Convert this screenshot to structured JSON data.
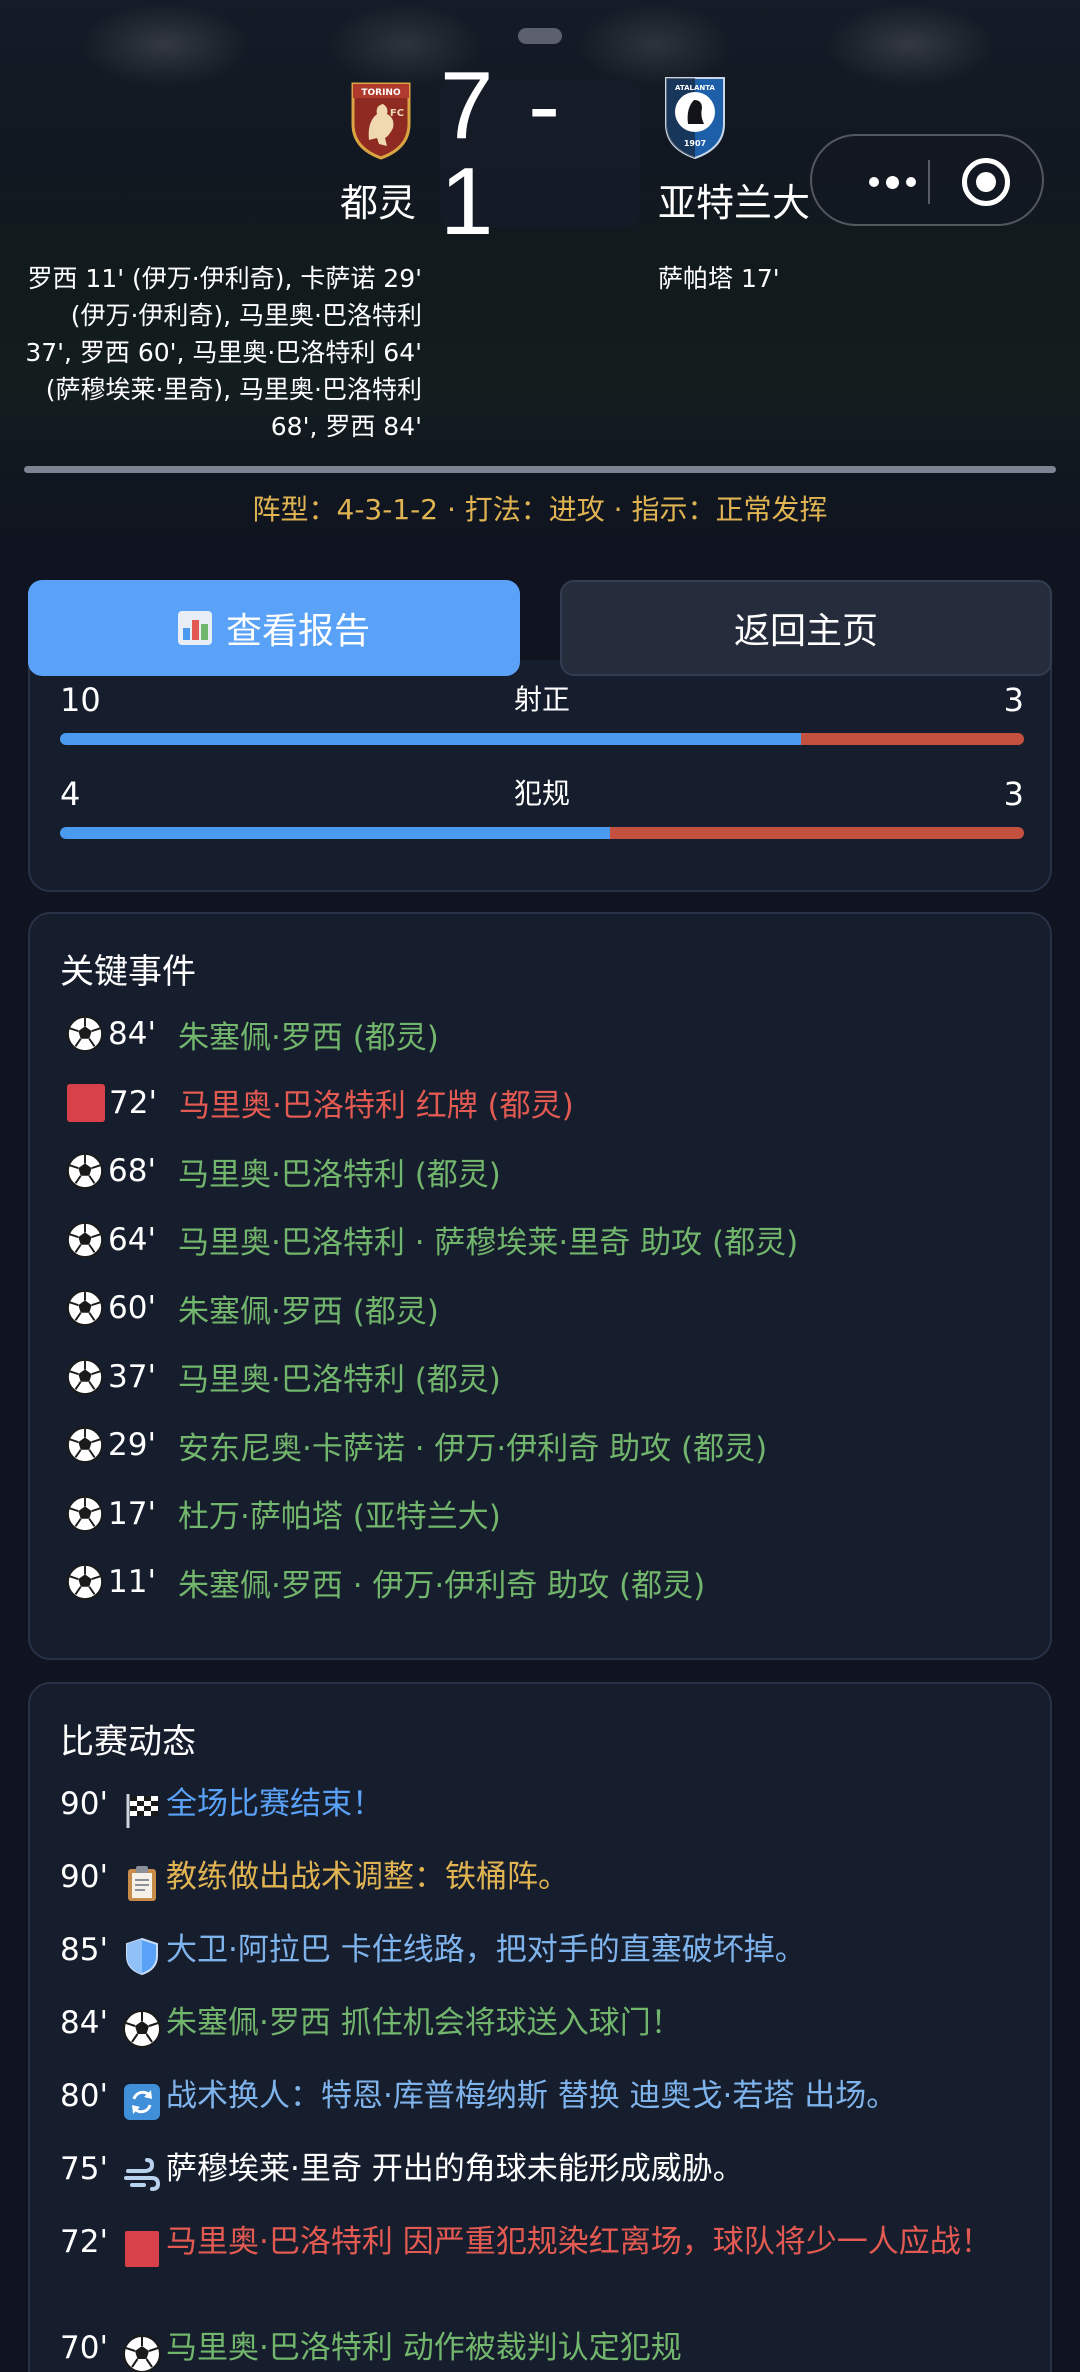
{
  "match": {
    "home_team": "都灵",
    "away_team": "亚特兰大",
    "score": "7 - 1",
    "home_scorers": "罗西 11' (伊万·伊利奇), 卡萨诺 29' (伊万·伊利奇), 马里奥·巴洛特利 37', 罗西 60', 马里奥·巴洛特利 64' (萨穆埃莱·里奇), 马里奥·巴洛特利 68', 罗西 84'",
    "away_scorers": "萨帕塔 17'",
    "formation_line": "阵型：4-3-1-2 · 打法：进攻 · 指示：正常发挥",
    "home_crest_text": "TORINO FC",
    "away_crest_text": "ATALANTA 1907"
  },
  "actions": {
    "report_label": "查看报告",
    "home_label": "返回主页"
  },
  "stats": [
    {
      "label": "射正",
      "home": "10",
      "away": "3",
      "home_share": 0.769
    },
    {
      "label": "犯规",
      "home": "4",
      "away": "3",
      "home_share": 0.571
    }
  ],
  "key_events": {
    "title": "关键事件",
    "items": [
      {
        "type": "goal",
        "minute": "84'",
        "text": "朱塞佩·罗西 (都灵)",
        "color": "green"
      },
      {
        "type": "red_card",
        "minute": "72'",
        "text": "马里奥·巴洛特利 红牌 (都灵)",
        "color": "red"
      },
      {
        "type": "goal",
        "minute": "68'",
        "text": "马里奥·巴洛特利 (都灵)",
        "color": "green"
      },
      {
        "type": "goal",
        "minute": "64'",
        "text": "马里奥·巴洛特利 · 萨穆埃莱·里奇 助攻 (都灵)",
        "color": "green"
      },
      {
        "type": "goal",
        "minute": "60'",
        "text": "朱塞佩·罗西 (都灵)",
        "color": "green"
      },
      {
        "type": "goal",
        "minute": "37'",
        "text": "马里奥·巴洛特利 (都灵)",
        "color": "green"
      },
      {
        "type": "goal",
        "minute": "29'",
        "text": "安东尼奥·卡萨诺 · 伊万·伊利奇 助攻 (都灵)",
        "color": "green"
      },
      {
        "type": "goal",
        "minute": "17'",
        "text": "杜万·萨帕塔 (亚特兰大)",
        "color": "green"
      },
      {
        "type": "goal",
        "minute": "11'",
        "text": "朱塞佩·罗西 · 伊万·伊利奇 助攻 (都灵)",
        "color": "green"
      }
    ]
  },
  "timeline": {
    "title": "比赛动态",
    "items": [
      {
        "minute": "90'",
        "icon": "checkered-flag-icon",
        "text": "全场比赛结束！",
        "color": "blue"
      },
      {
        "minute": "90'",
        "icon": "clipboard-icon",
        "text": "教练做出战术调整：铁桶阵。",
        "color": "gold"
      },
      {
        "minute": "85'",
        "icon": "shield-icon",
        "text": "大卫·阿拉巴 卡住线路，把对手的直塞破坏掉。",
        "color": "lblue"
      },
      {
        "minute": "84'",
        "icon": "soccer-ball-icon",
        "text": "朱塞佩·罗西 抓住机会将球送入球门！",
        "color": "green"
      },
      {
        "minute": "80'",
        "icon": "substitution-icon",
        "text": "战术换人：特恩·库普梅纳斯 替换 迪奥戈·若塔 出场。",
        "color": "lblue"
      },
      {
        "minute": "75'",
        "icon": "wind-icon",
        "text": "萨穆埃莱·里奇 开出的角球未能形成威胁。",
        "color": "white"
      },
      {
        "minute": "72'",
        "icon": "red-card-icon",
        "text": "马里奥·巴洛特利 因严重犯规染红离场，球队将少一人应战！",
        "color": "red"
      },
      {
        "minute": "70'",
        "icon": "soccer-ball-icon",
        "text": "马里奥·巴洛特利 动作被裁判认定犯规",
        "color": "green"
      }
    ]
  },
  "colors": {
    "home_bar": "#4a9af0",
    "away_bar": "#c4513f",
    "accent_blue": "#5aa2f7",
    "goal_green": "#72b56c",
    "card_red": "#e35a52",
    "formation_gold": "#e0b452"
  }
}
